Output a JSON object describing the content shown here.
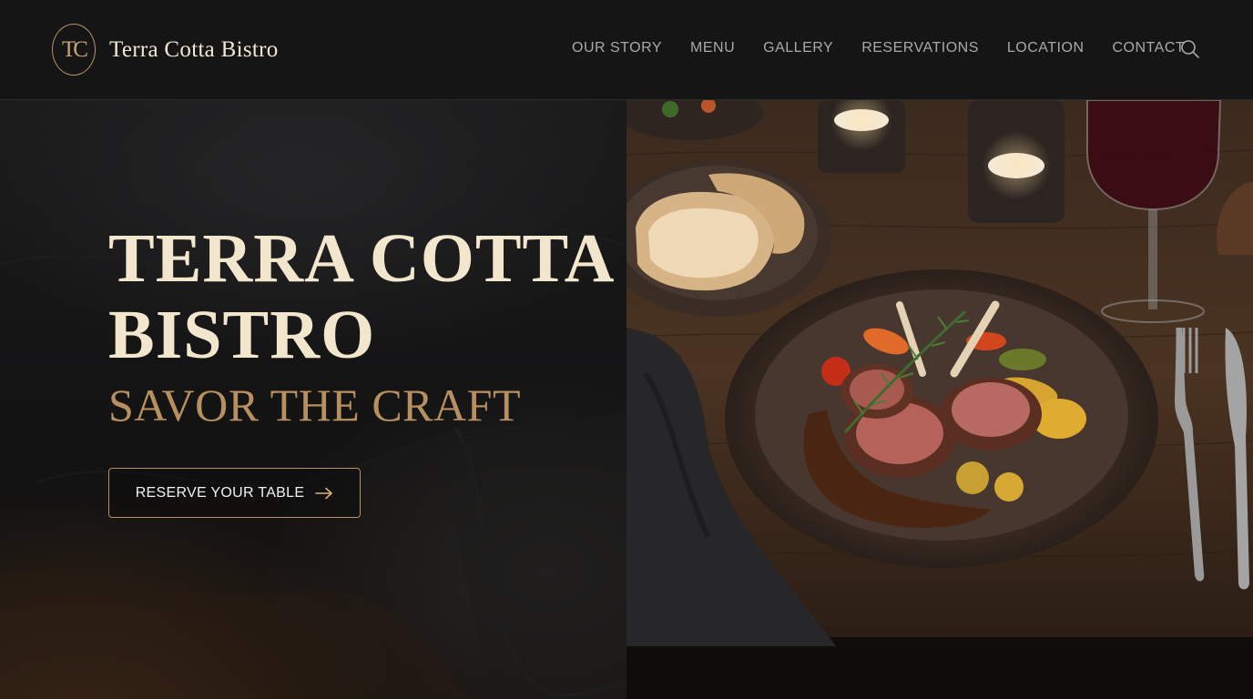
{
  "brand": {
    "monogram": "TC",
    "name": "Terra Cotta Bistro"
  },
  "nav": {
    "items": [
      "OUR STORY",
      "MENU",
      "GALLERY",
      "RESERVATIONS",
      "LOCATION",
      "CONTACT"
    ],
    "search_icon": "search-icon"
  },
  "hero": {
    "title_line1": "TERRA COTTA",
    "title_line2": "BISTRO",
    "tagline": "SAVOR THE CRAFT",
    "cta_label": "RESERVE YOUR TABLE",
    "cta_icon": "arrow-right-icon"
  },
  "colors": {
    "background": "#151515",
    "gold_accent": "#b8905f",
    "title_cream": "#f2e6cc",
    "nav_text": "#a9a9a9"
  }
}
